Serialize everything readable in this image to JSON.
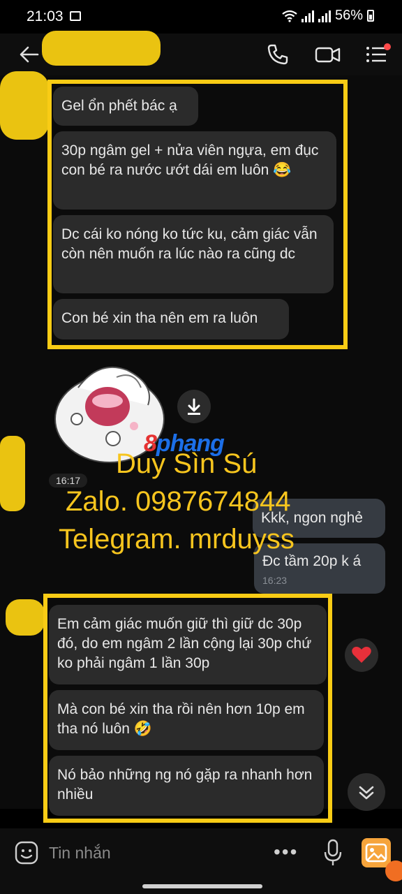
{
  "status_bar": {
    "time": "21:03",
    "battery": "56%"
  },
  "messages_top": [
    {
      "text": "Gel ổn phết bác ạ"
    },
    {
      "text": "30p ngâm gel + nửa viên ngựa, em đục con bé ra nước ướt dái em luôn 😂"
    },
    {
      "text": "Dc cái ko nóng ko tức ku, cảm giác vẫn còn nên muốn ra lúc nào ra cũng dc"
    },
    {
      "text": "Con bé xin tha nên em ra luôn"
    }
  ],
  "sticker_time": "16:17",
  "messages_out": [
    {
      "text": "Kkk, ngon nghẻ"
    },
    {
      "text": "Đc tầm 20p k á",
      "time": "16:23"
    }
  ],
  "messages_bottom": [
    {
      "text": "Em cảm giác muốn giữ thì giữ dc 30p đó, do em ngâm 2 lần cộng lại 30p chứ ko phải ngâm 1 lần 30p"
    },
    {
      "text": "Mà con bé xin tha rồi nên hơn 10p em tha nó luôn 🤣"
    },
    {
      "text": "Nó bảo những ng nó gặp ra nhanh hơn nhiều"
    }
  ],
  "watermark": {
    "logo_a": "8",
    "logo_b": "phang",
    "line1": "Duy Sìn Sú",
    "line2": "Zalo. 0987674844",
    "line3": "Telegram. mrduyss"
  },
  "input": {
    "placeholder": "Tin nhắn",
    "more": "•••"
  },
  "colors": {
    "highlight": "#f9cc15",
    "bubble_in": "#2b2b2b",
    "bubble_out": "#363b42",
    "reaction": "#e8303a"
  }
}
